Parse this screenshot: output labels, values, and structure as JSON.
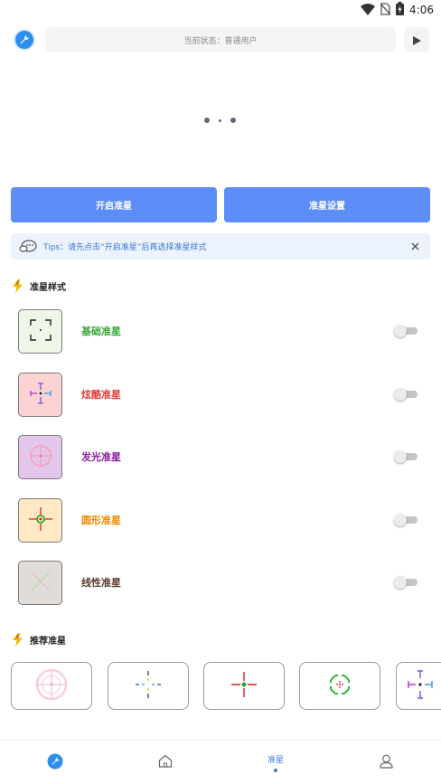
{
  "status_bar": {
    "time": "4:06"
  },
  "header": {
    "status_text": "当前状态：普通用户"
  },
  "actions": {
    "open_label": "开启准星",
    "settings_label": "准星设置"
  },
  "tips": {
    "text": "Tips：请先点击“开启准星”后再选择准星样式"
  },
  "styles_section": {
    "title": "准星样式",
    "items": [
      {
        "label": "基础准星",
        "color": "#3aa83a",
        "thumb_bg": "#eef6e8",
        "enabled": false
      },
      {
        "label": "炫酷准星",
        "color": "#e23b3b",
        "thumb_bg": "#fbd3d3",
        "enabled": false
      },
      {
        "label": "发光准星",
        "color": "#8a1fa0",
        "thumb_bg": "#e2c6ec",
        "enabled": false
      },
      {
        "label": "圆形准星",
        "color": "#f08a00",
        "thumb_bg": "#ffe8c4",
        "enabled": false
      },
      {
        "label": "线性准星",
        "color": "#5a3a2e",
        "thumb_bg": "#e2dcd8",
        "enabled": false
      }
    ]
  },
  "recommend_section": {
    "title": "推荐准星"
  },
  "bottom_nav": {
    "items": [
      {
        "label": "",
        "icon": "wrench-icon"
      },
      {
        "label": "",
        "icon": "home-icon"
      },
      {
        "label": "准星",
        "icon": "",
        "active": true
      },
      {
        "label": "",
        "icon": "user-icon"
      }
    ]
  },
  "colors": {
    "primary_button": "#5d8df6",
    "accent_blue": "#3a78d4",
    "tips_bg": "#ecf3fc"
  }
}
